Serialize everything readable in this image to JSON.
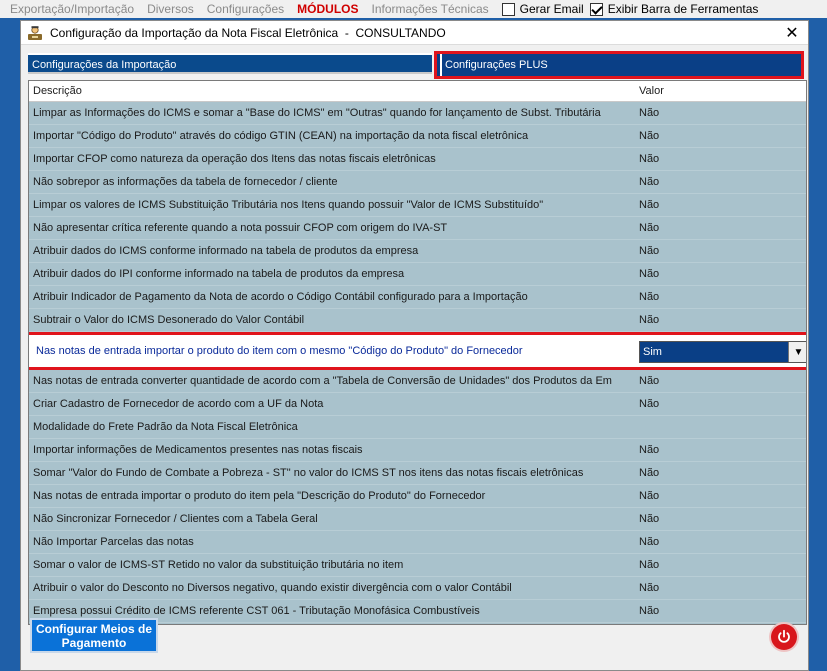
{
  "menubar": {
    "items": [
      "Exportação/Importação",
      "Diversos",
      "Configurações"
    ],
    "modules": "MÓDULOS",
    "info": "Informações Técnicas",
    "gerar_email": "Gerar Email",
    "exibir_barra": "Exibir Barra de Ferramentas",
    "gerar_email_checked": false,
    "exibir_barra_checked": true
  },
  "dialog": {
    "title": "Configuração da Importação da Nota Fiscal Eletrônica  -  CONSULTANDO",
    "close": "✕",
    "tabs": [
      "Configurações da Importação",
      "Configurações PLUS"
    ],
    "columns": {
      "descricao": "Descrição",
      "valor": "Valor"
    },
    "rows": [
      {
        "desc": "Limpar as Informações do ICMS e somar a \"Base do ICMS\" em \"Outras\" quando for lançamento de Subst. Tributária",
        "val": "Não"
      },
      {
        "desc": "Importar \"Código do Produto\" através do código GTIN (CEAN) na importação da nota fiscal eletrônica",
        "val": "Não"
      },
      {
        "desc": "Importar CFOP como natureza da operação dos Itens das notas fiscais eletrônicas",
        "val": "Não"
      },
      {
        "desc": "Não sobrepor as informações da tabela de fornecedor / cliente",
        "val": "Não"
      },
      {
        "desc": "Limpar os valores de ICMS Substituição Tributária nos Itens quando possuir \"Valor de ICMS Substituído\"",
        "val": "Não"
      },
      {
        "desc": "Não apresentar crítica referente quando a nota possuir CFOP com origem do IVA-ST",
        "val": "Não"
      },
      {
        "desc": "Atribuir dados do ICMS conforme informado na tabela de produtos da empresa",
        "val": "Não"
      },
      {
        "desc": "Atribuir dados do IPI conforme informado na tabela de produtos da empresa",
        "val": "Não"
      },
      {
        "desc": "Atribuir Indicador de Pagamento da Nota de acordo o Código Contábil configurado para a Importação",
        "val": "Não"
      },
      {
        "desc": "Subtrair o Valor do ICMS Desonerado do Valor Contábil",
        "val": "Não"
      },
      {
        "desc": "Nas notas de entrada importar o produto do item com o mesmo \"Código do Produto\" do Fornecedor",
        "val": "Sim"
      },
      {
        "desc": "Nas notas de entrada converter quantidade de acordo com a \"Tabela de Conversão de Unidades\" dos Produtos da Em",
        "val": "Não"
      },
      {
        "desc": "Criar Cadastro de Fornecedor de acordo com a UF da Nota",
        "val": "Não"
      },
      {
        "desc": "Modalidade do Frete Padrão da Nota Fiscal Eletrônica",
        "val": ""
      },
      {
        "desc": "Importar informações de Medicamentos presentes nas notas fiscais",
        "val": "Não"
      },
      {
        "desc": "Somar \"Valor do Fundo de Combate a Pobreza - ST\" no valor do ICMS ST nos itens das notas fiscais eletrônicas",
        "val": "Não"
      },
      {
        "desc": "Nas notas de entrada importar o produto do item pela \"Descrição do Produto\" do Fornecedor",
        "val": "Não"
      },
      {
        "desc": "Não Sincronizar Fornecedor / Clientes com a Tabela Geral",
        "val": "Não"
      },
      {
        "desc": "Não Importar Parcelas das notas",
        "val": "Não"
      },
      {
        "desc": "Somar o valor de ICMS-ST Retido no valor da substituição tributária no item",
        "val": "Não"
      },
      {
        "desc": "Atribuir o valor do Desconto no Diversos negativo, quando existir divergência com o valor Contábil",
        "val": "Não"
      },
      {
        "desc": "Empresa possui Crédito de ICMS referente CST 061 - Tributação Monofásica Combustíveis",
        "val": "Não"
      }
    ],
    "selected_row_index": 10,
    "payment_button": "Configurar Meios de Pagamento"
  },
  "colors": {
    "accent_red": "#e0141c",
    "tab_blue": "#0a4a8c",
    "grid_bg": "#a9c2cc",
    "button_blue": "#0a72d8"
  }
}
